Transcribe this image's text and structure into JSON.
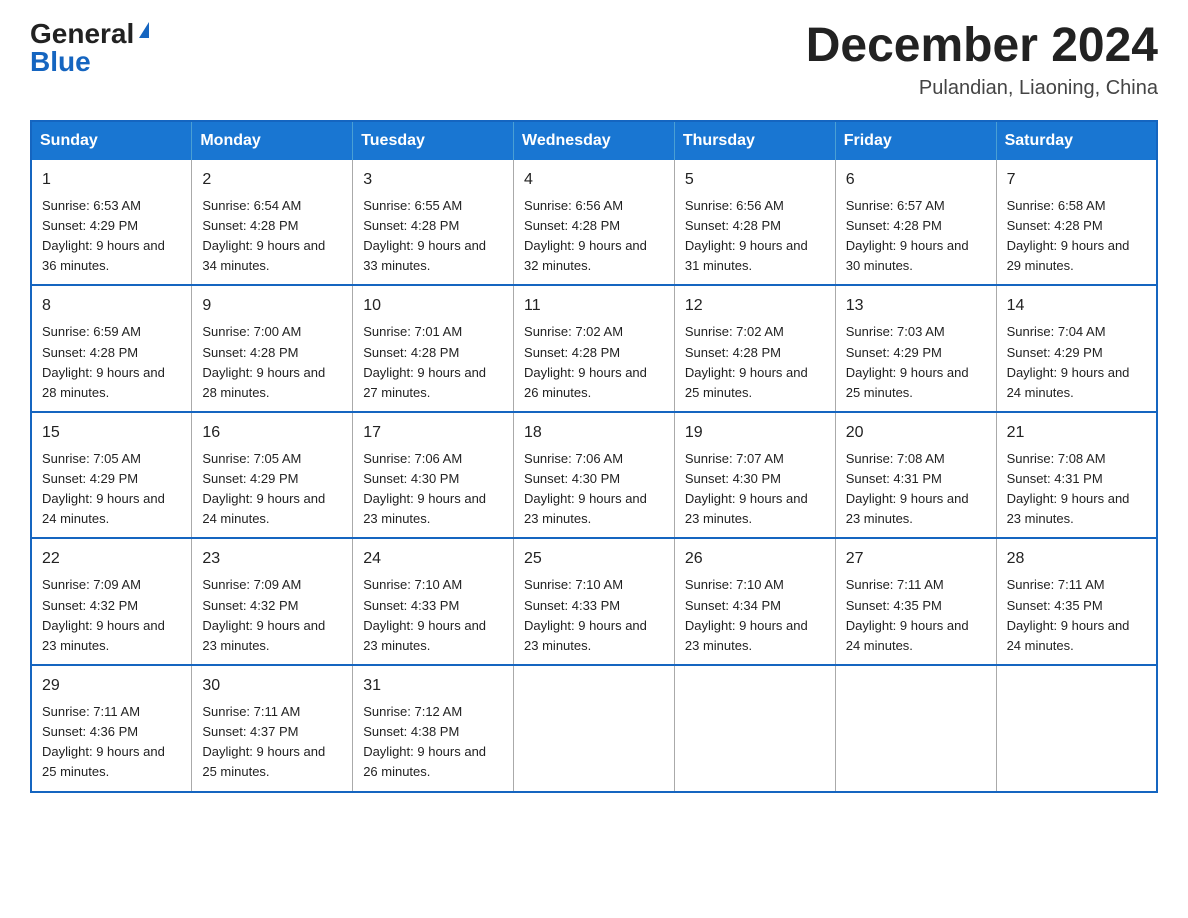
{
  "header": {
    "logo_general": "General",
    "logo_blue": "Blue",
    "month_title": "December 2024",
    "subtitle": "Pulandian, Liaoning, China"
  },
  "days_of_week": [
    "Sunday",
    "Monday",
    "Tuesday",
    "Wednesday",
    "Thursday",
    "Friday",
    "Saturday"
  ],
  "weeks": [
    [
      {
        "day": "1",
        "sunrise": "6:53 AM",
        "sunset": "4:29 PM",
        "daylight": "9 hours and 36 minutes."
      },
      {
        "day": "2",
        "sunrise": "6:54 AM",
        "sunset": "4:28 PM",
        "daylight": "9 hours and 34 minutes."
      },
      {
        "day": "3",
        "sunrise": "6:55 AM",
        "sunset": "4:28 PM",
        "daylight": "9 hours and 33 minutes."
      },
      {
        "day": "4",
        "sunrise": "6:56 AM",
        "sunset": "4:28 PM",
        "daylight": "9 hours and 32 minutes."
      },
      {
        "day": "5",
        "sunrise": "6:56 AM",
        "sunset": "4:28 PM",
        "daylight": "9 hours and 31 minutes."
      },
      {
        "day": "6",
        "sunrise": "6:57 AM",
        "sunset": "4:28 PM",
        "daylight": "9 hours and 30 minutes."
      },
      {
        "day": "7",
        "sunrise": "6:58 AM",
        "sunset": "4:28 PM",
        "daylight": "9 hours and 29 minutes."
      }
    ],
    [
      {
        "day": "8",
        "sunrise": "6:59 AM",
        "sunset": "4:28 PM",
        "daylight": "9 hours and 28 minutes."
      },
      {
        "day": "9",
        "sunrise": "7:00 AM",
        "sunset": "4:28 PM",
        "daylight": "9 hours and 28 minutes."
      },
      {
        "day": "10",
        "sunrise": "7:01 AM",
        "sunset": "4:28 PM",
        "daylight": "9 hours and 27 minutes."
      },
      {
        "day": "11",
        "sunrise": "7:02 AM",
        "sunset": "4:28 PM",
        "daylight": "9 hours and 26 minutes."
      },
      {
        "day": "12",
        "sunrise": "7:02 AM",
        "sunset": "4:28 PM",
        "daylight": "9 hours and 25 minutes."
      },
      {
        "day": "13",
        "sunrise": "7:03 AM",
        "sunset": "4:29 PM",
        "daylight": "9 hours and 25 minutes."
      },
      {
        "day": "14",
        "sunrise": "7:04 AM",
        "sunset": "4:29 PM",
        "daylight": "9 hours and 24 minutes."
      }
    ],
    [
      {
        "day": "15",
        "sunrise": "7:05 AM",
        "sunset": "4:29 PM",
        "daylight": "9 hours and 24 minutes."
      },
      {
        "day": "16",
        "sunrise": "7:05 AM",
        "sunset": "4:29 PM",
        "daylight": "9 hours and 24 minutes."
      },
      {
        "day": "17",
        "sunrise": "7:06 AM",
        "sunset": "4:30 PM",
        "daylight": "9 hours and 23 minutes."
      },
      {
        "day": "18",
        "sunrise": "7:06 AM",
        "sunset": "4:30 PM",
        "daylight": "9 hours and 23 minutes."
      },
      {
        "day": "19",
        "sunrise": "7:07 AM",
        "sunset": "4:30 PM",
        "daylight": "9 hours and 23 minutes."
      },
      {
        "day": "20",
        "sunrise": "7:08 AM",
        "sunset": "4:31 PM",
        "daylight": "9 hours and 23 minutes."
      },
      {
        "day": "21",
        "sunrise": "7:08 AM",
        "sunset": "4:31 PM",
        "daylight": "9 hours and 23 minutes."
      }
    ],
    [
      {
        "day": "22",
        "sunrise": "7:09 AM",
        "sunset": "4:32 PM",
        "daylight": "9 hours and 23 minutes."
      },
      {
        "day": "23",
        "sunrise": "7:09 AM",
        "sunset": "4:32 PM",
        "daylight": "9 hours and 23 minutes."
      },
      {
        "day": "24",
        "sunrise": "7:10 AM",
        "sunset": "4:33 PM",
        "daylight": "9 hours and 23 minutes."
      },
      {
        "day": "25",
        "sunrise": "7:10 AM",
        "sunset": "4:33 PM",
        "daylight": "9 hours and 23 minutes."
      },
      {
        "day": "26",
        "sunrise": "7:10 AM",
        "sunset": "4:34 PM",
        "daylight": "9 hours and 23 minutes."
      },
      {
        "day": "27",
        "sunrise": "7:11 AM",
        "sunset": "4:35 PM",
        "daylight": "9 hours and 24 minutes."
      },
      {
        "day": "28",
        "sunrise": "7:11 AM",
        "sunset": "4:35 PM",
        "daylight": "9 hours and 24 minutes."
      }
    ],
    [
      {
        "day": "29",
        "sunrise": "7:11 AM",
        "sunset": "4:36 PM",
        "daylight": "9 hours and 25 minutes."
      },
      {
        "day": "30",
        "sunrise": "7:11 AM",
        "sunset": "4:37 PM",
        "daylight": "9 hours and 25 minutes."
      },
      {
        "day": "31",
        "sunrise": "7:12 AM",
        "sunset": "4:38 PM",
        "daylight": "9 hours and 26 minutes."
      },
      null,
      null,
      null,
      null
    ]
  ]
}
